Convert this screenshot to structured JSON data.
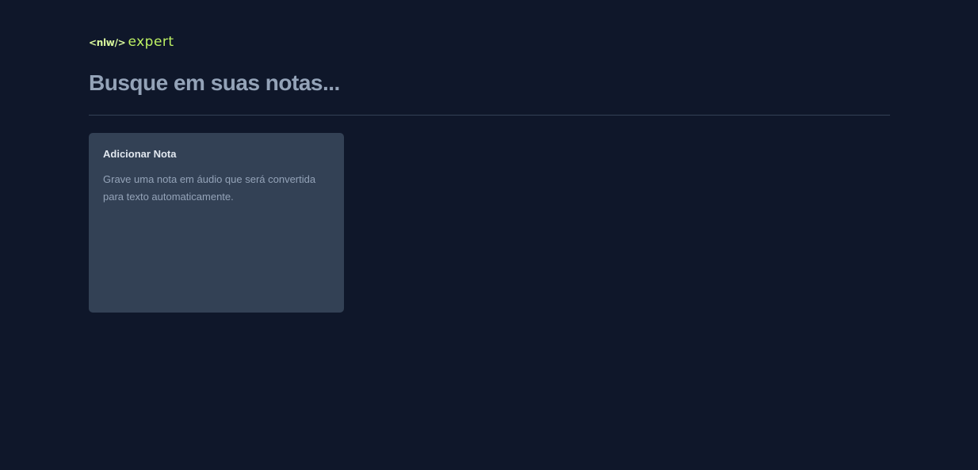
{
  "logo": {
    "nlw": "<nlw/>",
    "expert": "expert"
  },
  "search": {
    "placeholder": "Busque em suas notas...",
    "value": ""
  },
  "notes": [
    {
      "title": "Adicionar Nota",
      "description": "Grave uma nota em áudio que será convertida para texto automaticamente."
    }
  ],
  "colors": {
    "background": "#0f172a",
    "accent": "#bef264",
    "card": "#334155",
    "divider": "#334155"
  }
}
